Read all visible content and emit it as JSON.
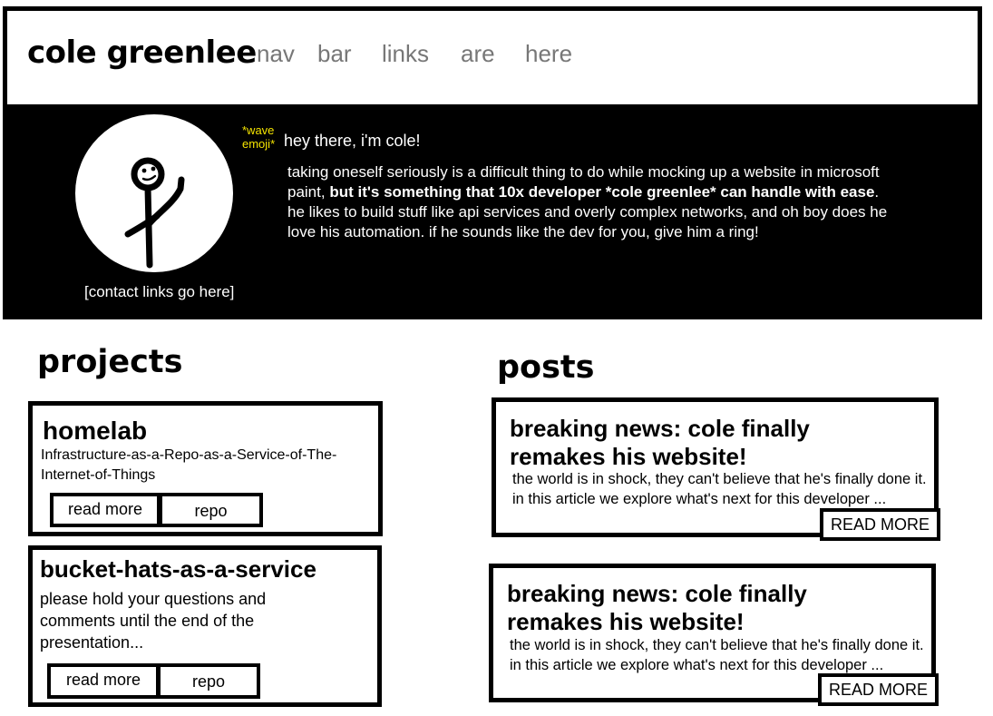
{
  "header": {
    "brand": "cole greenlee",
    "nav": [
      "nav",
      "bar",
      "links",
      "are",
      "here"
    ]
  },
  "hero": {
    "wave_note": "*wave emoji*",
    "greeting": "hey there, i'm cole!",
    "bio_part1": "taking oneself seriously is a difficult thing to do while mocking up a website in microsoft paint, ",
    "bio_bold": "but it's something that 10x developer *cole greenlee* can handle with ease",
    "bio_part2": ".  he likes to build stuff like api services and overly complex networks, and oh boy does he love his automation. if he sounds like the dev for you, give him a ring!",
    "contact": "[contact links go here]",
    "avatar_icon": "stick-figure-avatar"
  },
  "projects": {
    "title": "projects",
    "items": [
      {
        "name": "homelab",
        "description": "Infrastructure-as-a-Repo-as-a-Service-of-The-Internet-of-Things",
        "read_more": "read more",
        "repo": "repo"
      },
      {
        "name": "bucket-hats-as-a-service",
        "description": "please hold your questions and comments until the end of the presentation...",
        "read_more": "read more",
        "repo": "repo"
      }
    ]
  },
  "posts": {
    "title": "posts",
    "items": [
      {
        "title": "breaking news: cole finally remakes his website!",
        "excerpt": "the world is in shock, they can't believe that he's finally done it. in this article we explore what's next for this developer ...",
        "read_more": "READ MORE"
      },
      {
        "title": "breaking news: cole finally remakes his website!",
        "excerpt": "the world is in shock, they can't believe that he's finally done it. in this article we explore what's next for this developer ...",
        "read_more": "READ MORE"
      }
    ]
  },
  "colors": {
    "hero_bg": "#000000",
    "wave_note": "#f5e400",
    "nav_link": "#777777"
  }
}
